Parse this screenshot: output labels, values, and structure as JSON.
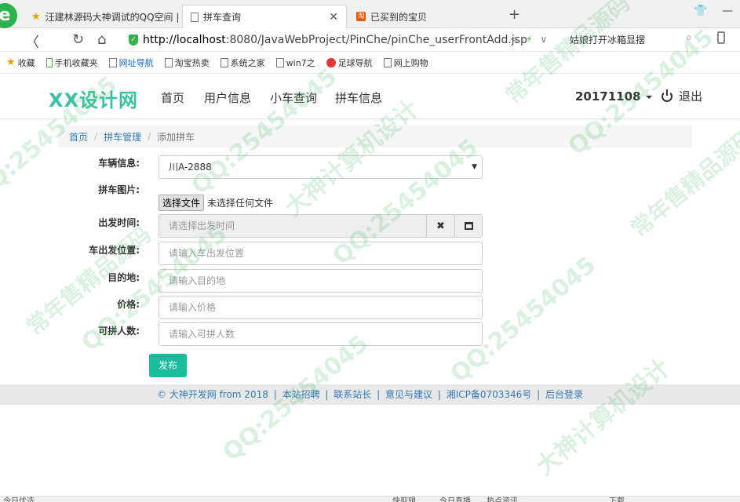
{
  "browser": {
    "tabs": [
      {
        "label": "汪建林源码大神调试的QQ空间 |",
        "icon": "star-icon"
      },
      {
        "label": "拼车查询",
        "icon": "page-icon"
      },
      {
        "label": "已买到的宝贝",
        "icon": "taobao-icon"
      }
    ],
    "new_tab_symbol": "+",
    "url_host": "http://localhost",
    "url_path": ":8080/JavaWebProject/PinChe/pinChe_userFrontAdd.jsp",
    "search_text": "姑娘打开冰箱显摆",
    "bookmarks": [
      {
        "label": "收藏",
        "icon": "star-icon"
      },
      {
        "label": "手机收藏夹",
        "icon": "phone-icon"
      },
      {
        "label": "网址导航",
        "icon": "page-icon"
      },
      {
        "label": "淘宝热卖",
        "icon": "page-icon"
      },
      {
        "label": "系统之家",
        "icon": "page-icon"
      },
      {
        "label": "win7之",
        "icon": "page-icon"
      },
      {
        "label": "足球导航",
        "icon": "ball-icon"
      },
      {
        "label": "网上购物",
        "icon": "page-icon"
      }
    ]
  },
  "site": {
    "brand": "XX设计网",
    "nav": [
      "首页",
      "用户信息",
      "小车查询",
      "拼车信息"
    ],
    "user": "20171108",
    "logout": "退出"
  },
  "breadcrumb": {
    "home": "首页",
    "section": "拼车管理",
    "current": "添加拼车",
    "separator": "/"
  },
  "form": {
    "car_label": "车辆信息:",
    "car_value": "川A-2888",
    "image_label": "拼车图片:",
    "file_button": "选择文件",
    "file_status": "未选择任何文件",
    "depart_time_label": "出发时间:",
    "depart_time_placeholder": "请选择出发时间",
    "depart_place_label": "车出发位置:",
    "depart_place_placeholder": "请输入车出发位置",
    "dest_label": "目的地:",
    "dest_placeholder": "请输入目的地",
    "price_label": "价格:",
    "price_placeholder": "请输入价格",
    "seats_label": "可拼人数:",
    "seats_placeholder": "请输入可拼人数",
    "submit": "发布"
  },
  "footer": {
    "copyright": "© 大神开发网 from 2018",
    "links": [
      "本站招聘",
      "联系站长",
      "意见与建议",
      "湘ICP备0703346号",
      "后台登录"
    ],
    "separator": "|"
  },
  "statusbar": {
    "left": "今日优选",
    "items": [
      "快剪辑",
      "今日直播",
      "热点资讯",
      "下载"
    ]
  },
  "watermark": {
    "qq": "QQ:25454045",
    "design": "大神计算机设计",
    "source": "常年售精品源码"
  },
  "colors": {
    "brand": "#3cc0a3",
    "submit": "#1abc9c",
    "link": "#337ab7"
  }
}
